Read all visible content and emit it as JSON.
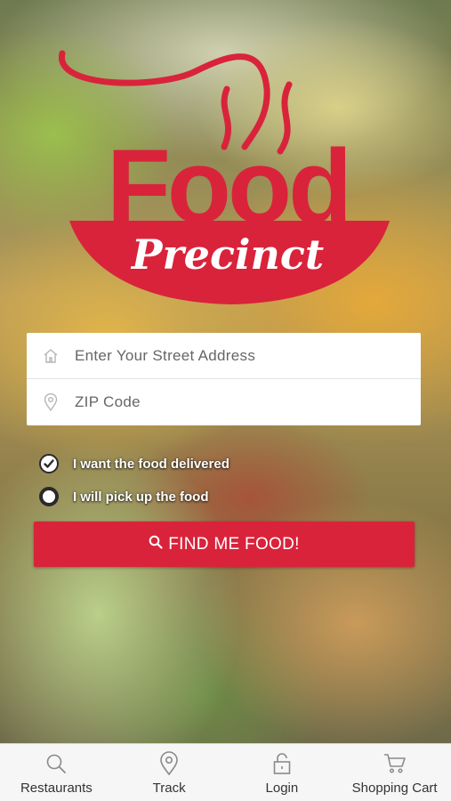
{
  "brand": {
    "logo_word_top": "Food",
    "logo_word_bottom": "Precinct",
    "accent_color": "#d9233b"
  },
  "search": {
    "address_placeholder": "Enter Your Street Address",
    "address_icon": "home-icon",
    "zip_placeholder": "ZIP Code",
    "zip_icon": "location-pin-icon"
  },
  "options": {
    "delivered_label": "I want the food delivered",
    "delivered_selected": true,
    "pickup_label": "I will pick up the food",
    "pickup_selected": false
  },
  "find_button": {
    "label": "FIND ME FOOD!",
    "icon": "search-icon"
  },
  "tabbar": {
    "items": [
      {
        "label": "Restaurants",
        "icon": "search-icon"
      },
      {
        "label": "Track",
        "icon": "location-pin-icon"
      },
      {
        "label": "Login",
        "icon": "lock-icon"
      },
      {
        "label": "Shopping Cart",
        "icon": "cart-icon"
      }
    ]
  }
}
